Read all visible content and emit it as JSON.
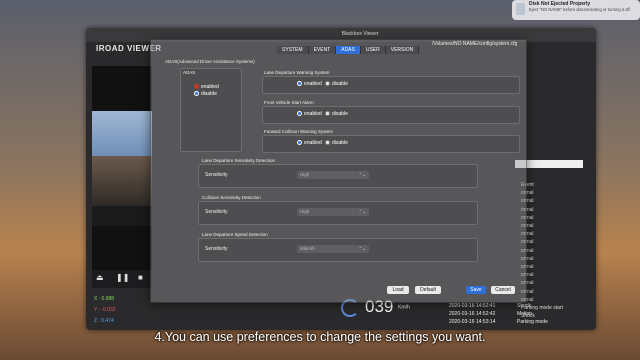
{
  "window": {
    "title": "Blackbox Viewer",
    "logo": "IROAD VIEWER",
    "path": "/Volumes/NO NAME/config/system.cfg"
  },
  "notification": {
    "title": "Disk Not Ejected Properly",
    "body": "Eject \"NO NAME\" before disconnecting or turning it off."
  },
  "tabs": [
    {
      "label": "SYSTEM",
      "active": false
    },
    {
      "label": "EVENT",
      "active": false
    },
    {
      "label": "ADAS",
      "active": true
    },
    {
      "label": "USER",
      "active": false
    },
    {
      "label": "VERSION",
      "active": false
    }
  ],
  "adas": {
    "section_title": "ADAS(Advanced Driver Assistance Systems)",
    "master": {
      "label": "ADAS",
      "enabled": "enabled",
      "disable": "disable",
      "selected": "disable"
    },
    "ldws": {
      "title": "Lane Departure Warning System",
      "enabled": "enabled",
      "disable": "disable",
      "selected": "enabled"
    },
    "fvsa": {
      "title": "Front Vehicle Start Alarm",
      "enabled": "enabled",
      "disable": "disable",
      "selected": "enabled"
    },
    "fcws": {
      "title": "Forward Collision Warning System",
      "enabled": "enabled",
      "disable": "disable",
      "selected": "enabled"
    },
    "ld_sens": {
      "title": "Lane Departure Sensitivity Detection",
      "label": "Sensitivity",
      "value": "High"
    },
    "fc_sens": {
      "title": "Collision Sensitivity Detection",
      "label": "Sensitivity",
      "value": "High"
    },
    "ld_speed": {
      "title": "Lane Departure Speed Detection",
      "label": "Sensitivity",
      "value": "60km/h"
    }
  },
  "buttons": {
    "load": "Load",
    "default": "Default",
    "save": "Save",
    "cancel": "Cancel"
  },
  "sensor": {
    "x": "X : 0.988",
    "y": "Y : -0.032",
    "z": "Z : 0.474"
  },
  "speed": {
    "value": "039",
    "unit": "Km/h"
  },
  "right_list": [
    "Event",
    "ormal",
    "ormal",
    "ormal",
    "ormal",
    "ormal",
    "ormal",
    "ormal",
    "ormal",
    "ormal",
    "ormal",
    "ormal",
    "ormal",
    "ormal",
    "ormal",
    "Parking mode start",
    "Shock"
  ],
  "events": [
    {
      "time": "2020-03-16 14:52:41",
      "type": "Shock"
    },
    {
      "time": "2020-03-16 14:52:42",
      "type": "Motion"
    },
    {
      "time": "2020-03-16 14:53:14",
      "type": "Parking mode"
    }
  ],
  "caption": "4.You can use preferences to change the settings you want."
}
